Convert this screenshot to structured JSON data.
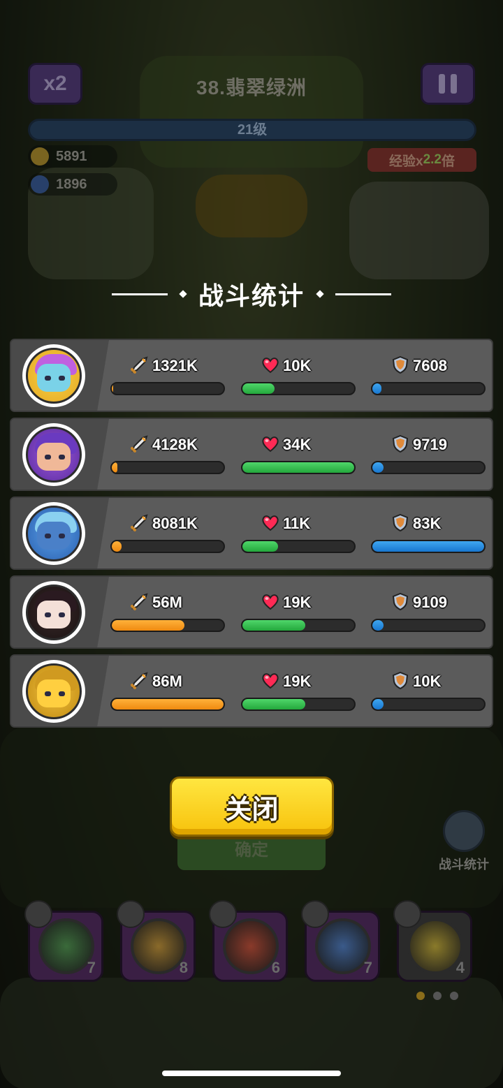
{
  "hud": {
    "speed_label": "x2",
    "level_name": "38.翡翠绿洲",
    "level_progress": "21级",
    "gold": "5891",
    "gems": "1896",
    "exp_prefix": "经验x",
    "exp_multiplier": "2.2",
    "exp_suffix": "倍"
  },
  "stats_title": "战斗统计",
  "heroes": [
    {
      "avatar": "hero-knight-gold-helmet",
      "damage": "1321K",
      "damage_fill": 0.01,
      "heal": "10K",
      "heal_fill": 0.29,
      "shield": "7608",
      "shield_fill": 0.08
    },
    {
      "avatar": "hero-purple-hair",
      "damage": "4128K",
      "damage_fill": 0.05,
      "heal": "34K",
      "heal_fill": 1.0,
      "shield": "9719",
      "shield_fill": 0.1
    },
    {
      "avatar": "hero-blue-robot",
      "damage": "8081K",
      "damage_fill": 0.09,
      "heal": "11K",
      "heal_fill": 0.32,
      "shield": "83K",
      "shield_fill": 1.0
    },
    {
      "avatar": "hero-black-hair",
      "damage": "56M",
      "damage_fill": 0.65,
      "heal": "19K",
      "heal_fill": 0.56,
      "shield": "9109",
      "shield_fill": 0.1
    },
    {
      "avatar": "hero-gold-mech",
      "damage": "86M",
      "damage_fill": 1.0,
      "heal": "19K",
      "heal_fill": 0.56,
      "shield": "10K",
      "shield_fill": 0.1
    }
  ],
  "close_button": "关闭",
  "behind_button": "确定",
  "side_stats_label": "战斗统计",
  "skill_slots": [
    {
      "level": "7"
    },
    {
      "level": "8"
    },
    {
      "level": "6"
    },
    {
      "level": "7"
    },
    {
      "level": "4"
    }
  ],
  "colors": {
    "damage": "#f08a10",
    "heal": "#24a83c",
    "shield": "#1877d0",
    "button": "#f7c20c"
  }
}
